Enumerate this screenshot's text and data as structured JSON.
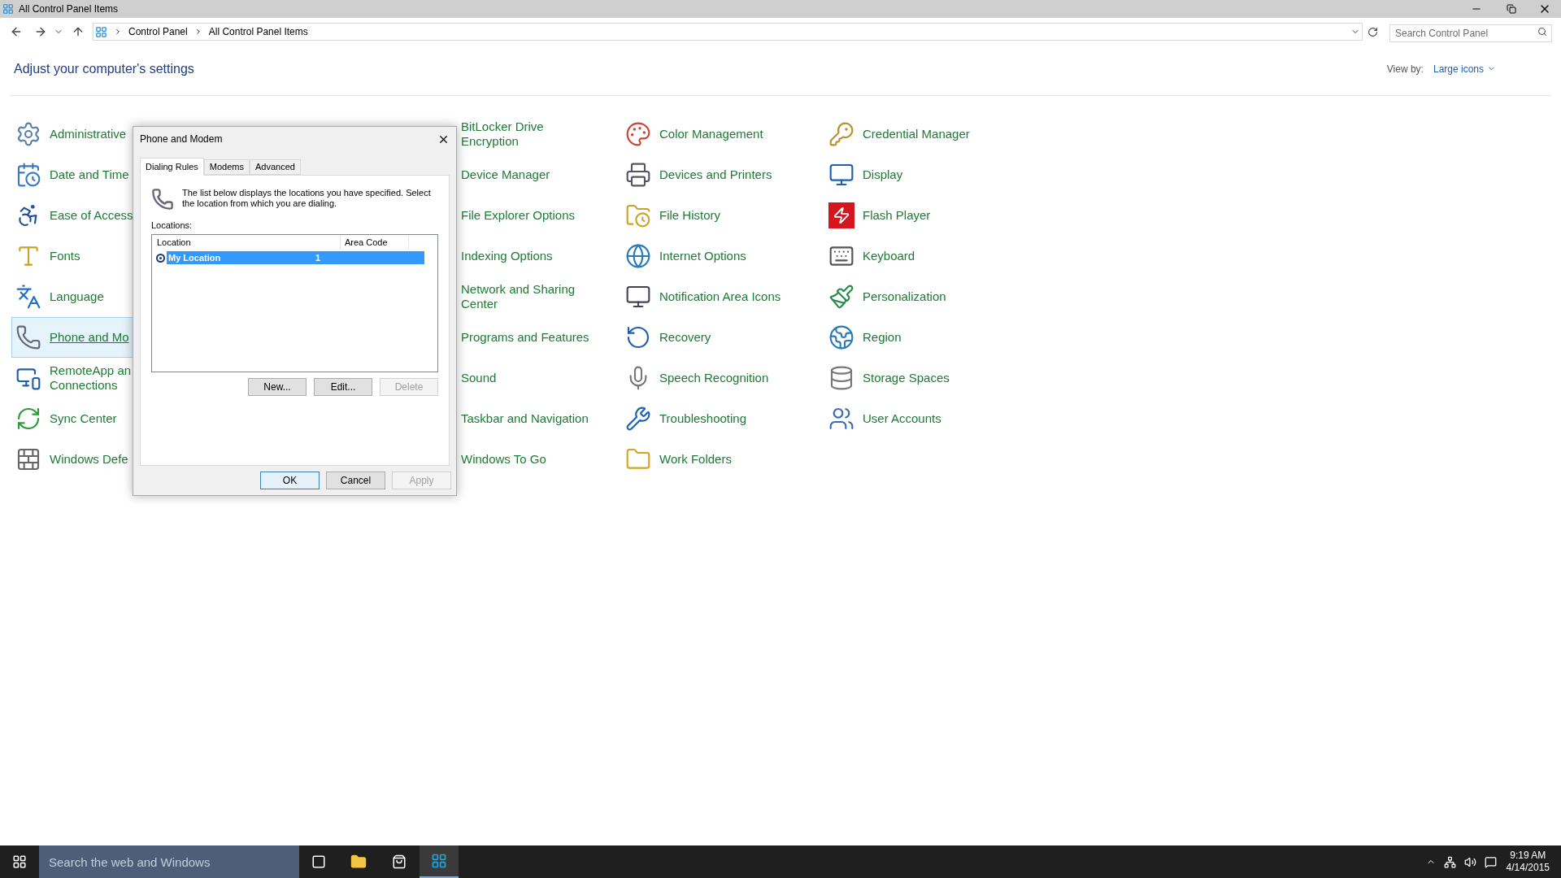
{
  "window": {
    "title": "All Control Panel Items"
  },
  "address_bar": {
    "breadcrumbs": [
      "Control Panel",
      "All Control Panel Items"
    ],
    "search": {
      "placeholder": "Search Control Panel"
    }
  },
  "header": {
    "title": "Adjust your computer's settings",
    "view_by_label": "View by:",
    "view_by_value": "Large icons"
  },
  "item_columns": [
    [
      {
        "label": "Administrative",
        "selected": false
      },
      {
        "label": "Date and Time",
        "selected": false
      },
      {
        "label": "Ease of Access",
        "selected": false
      },
      {
        "label": "Fonts",
        "selected": false
      },
      {
        "label": "Language",
        "selected": false
      },
      {
        "label": "Phone and Mo",
        "selected": true
      },
      {
        "label": "RemoteApp an Connections",
        "selected": false
      },
      {
        "label": "Sync Center",
        "selected": false
      },
      {
        "label": "Windows Defe",
        "selected": false
      }
    ],
    [
      {
        "label": "BitLocker Drive Encryption",
        "selected": false
      },
      {
        "label": "Device Manager",
        "selected": false
      },
      {
        "label": "File Explorer Options",
        "selected": false
      },
      {
        "label": "Indexing Options",
        "selected": false
      },
      {
        "label": "Network and Sharing Center",
        "selected": false
      },
      {
        "label": "Programs and Features",
        "selected": false
      },
      {
        "label": "Sound",
        "selected": false
      },
      {
        "label": "Taskbar and Navigation",
        "selected": false
      },
      {
        "label": "Windows To Go",
        "selected": false
      }
    ],
    [
      {
        "label": "Color Management",
        "selected": false
      },
      {
        "label": "Devices and Printers",
        "selected": false
      },
      {
        "label": "File History",
        "selected": false
      },
      {
        "label": "Internet Options",
        "selected": false
      },
      {
        "label": "Notification Area Icons",
        "selected": false
      },
      {
        "label": "Recovery",
        "selected": false
      },
      {
        "label": "Speech Recognition",
        "selected": false
      },
      {
        "label": "Troubleshooting",
        "selected": false
      },
      {
        "label": "Work Folders",
        "selected": false
      }
    ],
    [
      {
        "label": "Credential Manager",
        "selected": false
      },
      {
        "label": "Display",
        "selected": false
      },
      {
        "label": "Flash Player",
        "selected": false
      },
      {
        "label": "Keyboard",
        "selected": false
      },
      {
        "label": "Personalization",
        "selected": false
      },
      {
        "label": "Region",
        "selected": false
      },
      {
        "label": "Storage Spaces",
        "selected": false
      },
      {
        "label": "User Accounts",
        "selected": false
      }
    ]
  ],
  "dialog": {
    "title": "Phone and Modem",
    "tabs": [
      {
        "label": "Dialing Rules",
        "selected": true
      },
      {
        "label": "Modems",
        "selected": false
      },
      {
        "label": "Advanced",
        "selected": false
      }
    ],
    "description": "The list below displays the locations you have specified. Select the location from which you are dialing.",
    "locations_label": "Locations:",
    "columns": [
      "Location",
      "Area Code"
    ],
    "rows": [
      {
        "location": "My Location",
        "area_code": "1",
        "selected": true
      }
    ],
    "list_buttons": [
      {
        "label": "New...",
        "disabled": false
      },
      {
        "label": "Edit...",
        "disabled": false
      },
      {
        "label": "Delete",
        "disabled": true
      }
    ],
    "footer_buttons": [
      {
        "label": "OK",
        "disabled": false,
        "default": true
      },
      {
        "label": "Cancel",
        "disabled": false,
        "default": false
      },
      {
        "label": "Apply",
        "disabled": true,
        "default": false
      }
    ]
  },
  "taskbar": {
    "search": {
      "placeholder": "Search the web and Windows"
    },
    "clock": {
      "time": "9:19 AM",
      "date": "4/14/2015"
    }
  }
}
